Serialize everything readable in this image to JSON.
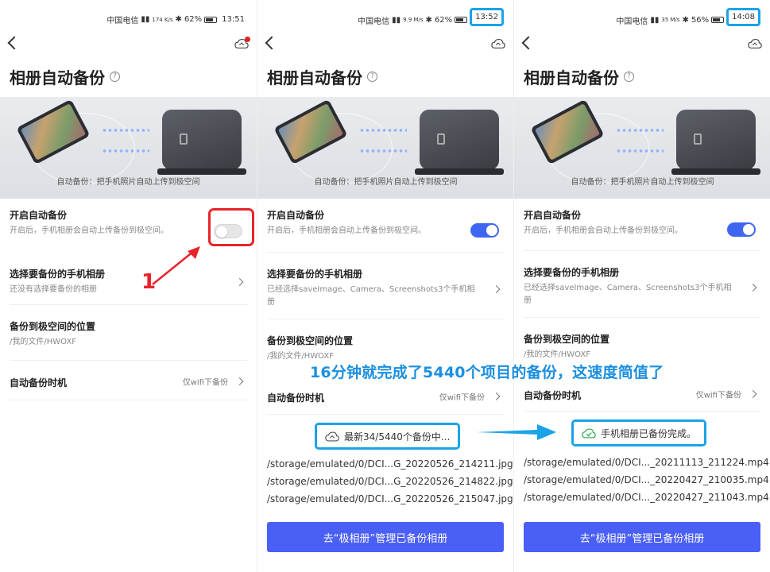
{
  "panels": [
    {
      "status": {
        "carrier": "中国电信",
        "speed": "174 K/s",
        "battery": "62%",
        "time": "13:51"
      },
      "title": "相册自动备份",
      "banner_caption": "自动备份：把手机照片自动上传到极空间",
      "auto_backup": {
        "label": "开启自动备份",
        "sub": "开启后，手机相册会自动上传备份到极空间。",
        "enabled": false
      },
      "albums": {
        "label": "选择要备份的手机相册",
        "sub": "还没有选择要备份的相册"
      },
      "location": {
        "label": "备份到极空间的位置",
        "sub": "/我的文件/HWOXF"
      },
      "timing": {
        "label": "自动备份时机",
        "value": "仅wifi下备份"
      }
    },
    {
      "status": {
        "carrier": "中国电信",
        "speed": "9.9 M/s",
        "battery": "62%",
        "time": "13:52"
      },
      "title": "相册自动备份",
      "banner_caption": "自动备份：把手机照片自动上传到极空间",
      "auto_backup": {
        "label": "开启自动备份",
        "sub": "开启后，手机相册会自动上传备份到极空间。",
        "enabled": true
      },
      "albums": {
        "label": "选择要备份的手机相册",
        "sub": "已经选择saveImage、Camera、Screenshots3个手机相册"
      },
      "location": {
        "label": "备份到极空间的位置",
        "sub": "/我的文件/HWOXF"
      },
      "timing": {
        "label": "自动备份时机",
        "value": "仅wifi下备份"
      },
      "progress": {
        "text": "最新34/5440个备份中...",
        "done": 34,
        "total": 5440
      },
      "files": [
        "/storage/emulated/0/DCI...G_20220526_214211.jpg",
        "/storage/emulated/0/DCI...G_20220526_214822.jpg",
        "/storage/emulated/0/DCI...G_20220526_215047.jpg"
      ],
      "cta": "去“极相册”管理已备份相册"
    },
    {
      "status": {
        "carrier": "中国电信",
        "speed": "35 M/s",
        "battery": "56%",
        "time": "14:08"
      },
      "title": "相册自动备份",
      "banner_caption": "自动备份：把手机照片自动上传到极空间",
      "auto_backup": {
        "label": "开启自动备份",
        "sub": "开启后，手机相册会自动上传备份到极空间。",
        "enabled": true
      },
      "albums": {
        "label": "选择要备份的手机相册",
        "sub": "已经选择saveImage、Camera、Screenshots3个手机相册"
      },
      "location": {
        "label": "备份到极空间的位置",
        "sub": "/我的文件/HWOXF"
      },
      "timing": {
        "label": "自动备份时机",
        "value": "仅wifi下备份"
      },
      "progress": {
        "text": "手机相册已备份完成。"
      },
      "files": [
        "/storage/emulated/0/DCI..._20211113_211224.mp4",
        "/storage/emulated/0/DCI..._20220427_210035.mp4",
        "/storage/emulated/0/DCI..._20220427_211043.mp4"
      ],
      "cta": "去“极相册”管理已备份相册"
    }
  ],
  "annotations": {
    "step_number": "1",
    "caption": "16分钟就完成了5440个项目的备份，这速度简值了",
    "colors": {
      "highlight": "#1aa3e8",
      "red": "#e8242b",
      "accent": "#4a5ff5"
    }
  }
}
